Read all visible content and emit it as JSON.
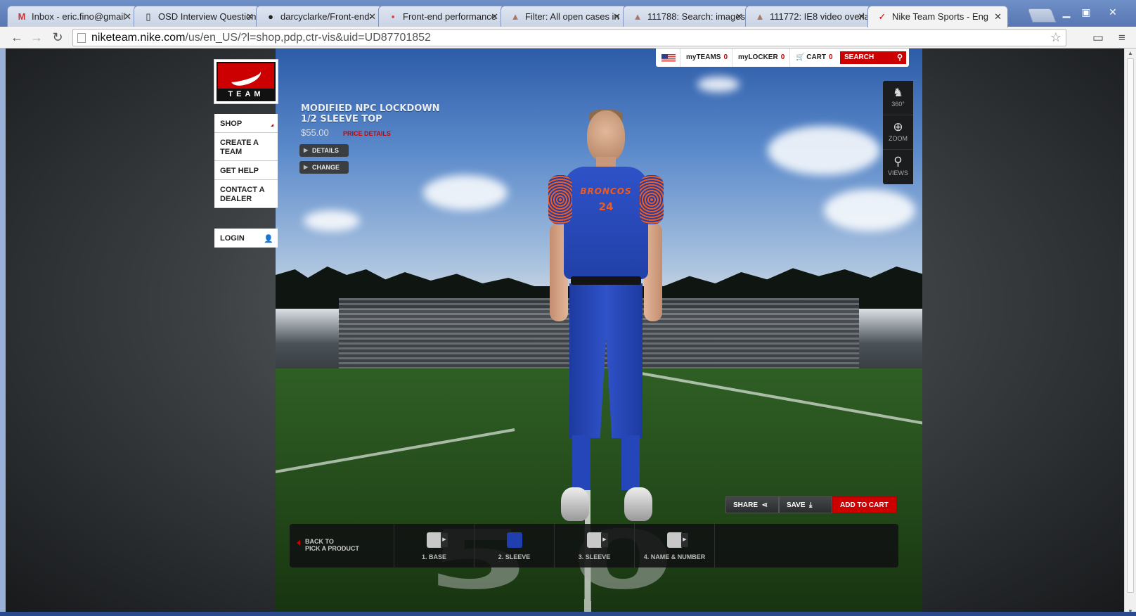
{
  "browser": {
    "tabs": [
      {
        "label": "Inbox - eric.fino@gmail",
        "icon": "gmail-icon",
        "glyph": "M"
      },
      {
        "label": "OSD Interview Question",
        "icon": "document-icon",
        "glyph": "▯"
      },
      {
        "label": "darcyclarke/Front-end-",
        "icon": "github-icon",
        "glyph": "●"
      },
      {
        "label": "Front-end performance",
        "icon": "css-icon",
        "glyph": "▪"
      },
      {
        "label": "Filter: All open cases in",
        "icon": "bug-icon",
        "glyph": "▲"
      },
      {
        "label": "111788: Search: images/",
        "icon": "bug-icon",
        "glyph": "▲"
      },
      {
        "label": "111772: IE8 video overla",
        "icon": "bug-icon",
        "glyph": "▲"
      },
      {
        "label": "Nike Team Sports - Eng",
        "icon": "nike-icon",
        "glyph": "✓"
      }
    ],
    "url_host": "niketeam.nike.com",
    "url_path": "/us/en_US/?l=shop,pdp,ctr-vis&uid=UD87701852",
    "close_glyph": "✕"
  },
  "site": {
    "logo_text": "TEAM",
    "nav": [
      {
        "label": "SHOP"
      },
      {
        "label": "CREATE A TEAM"
      },
      {
        "label": "GET HELP"
      },
      {
        "label": "CONTACT A DEALER"
      }
    ],
    "login_label": "LOGIN",
    "util": {
      "my_teams_label": "myTEAMS",
      "my_teams_count": "0",
      "my_locker_label": "myLOCKER",
      "my_locker_count": "0",
      "cart_label": "CART",
      "cart_count": "0",
      "search_placeholder": "SEARCH"
    },
    "product": {
      "title": "MODIFIED NPC LOCKDOWN 1/2 SLEEVE TOP",
      "price": "$55.00",
      "price_details": "PRICE DETAILS",
      "details_btn": "DETAILS",
      "change_btn": "CHANGE"
    },
    "jersey": {
      "team": "BRONCOS",
      "number": "24"
    },
    "field_number": "50",
    "view_tools": [
      {
        "label": "360°",
        "icon": "rotate-360-icon",
        "glyph": "♞"
      },
      {
        "label": "ZOOM",
        "icon": "zoom-icon",
        "glyph": "⊕"
      },
      {
        "label": "VIEWS",
        "icon": "views-icon",
        "glyph": "⚲"
      }
    ],
    "actions": {
      "share": "SHARE",
      "save": "SAVE",
      "add_to_cart": "ADD TO CART"
    },
    "stepbar": {
      "back_line1": "BACK TO",
      "back_line2": "PICK A PRODUCT",
      "steps": [
        {
          "label": "1. BASE",
          "color": "#c8c8c8"
        },
        {
          "label": "2. SLEEVE",
          "color": "#1f3fae"
        },
        {
          "label": "3. SLEEVE",
          "color": "#c8c8c8"
        },
        {
          "label": "4. NAME & NUMBER",
          "color": "#c8c8c8"
        }
      ]
    }
  },
  "colors": {
    "nike_red": "#cc0000",
    "uniform_blue": "#2140a8",
    "uniform_orange": "#f05a1e"
  }
}
